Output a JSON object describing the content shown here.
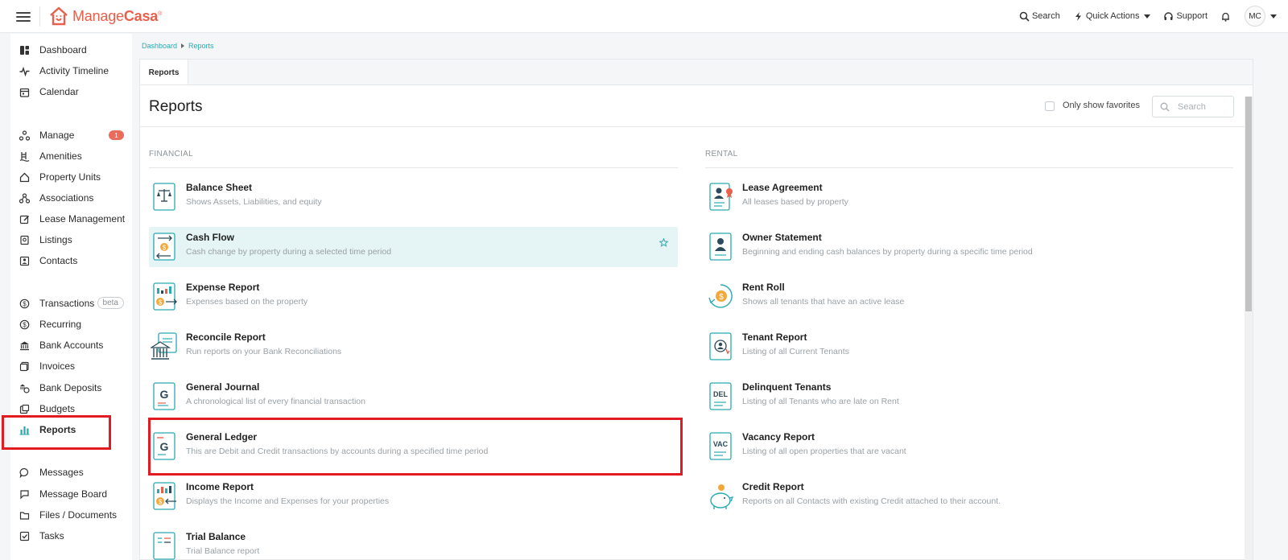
{
  "app": {
    "logo_text_light": "Manage",
    "logo_text_bold": "Casa"
  },
  "topbar": {
    "search_label": "Search",
    "quick_actions_label": "Quick Actions",
    "support_label": "Support",
    "avatar_initials": "MC"
  },
  "sidebar": {
    "items": [
      {
        "label": "Dashboard",
        "icon": "dashboard-icon"
      },
      {
        "label": "Activity Timeline",
        "icon": "pulse-icon"
      },
      {
        "label": "Calendar",
        "icon": "calendar-icon"
      },
      {
        "label": "Manage",
        "icon": "manage-icon",
        "badge": "1"
      },
      {
        "label": "Amenities",
        "icon": "amenities-icon"
      },
      {
        "label": "Property Units",
        "icon": "home-icon"
      },
      {
        "label": "Associations",
        "icon": "associations-icon"
      },
      {
        "label": "Lease Management",
        "icon": "edit-icon"
      },
      {
        "label": "Listings",
        "icon": "listings-icon"
      },
      {
        "label": "Contacts",
        "icon": "contacts-icon"
      },
      {
        "label": "Transactions",
        "icon": "dollar-icon",
        "tag": "beta"
      },
      {
        "label": "Recurring",
        "icon": "recurring-icon"
      },
      {
        "label": "Bank Accounts",
        "icon": "bank-icon"
      },
      {
        "label": "Invoices",
        "icon": "invoice-icon"
      },
      {
        "label": "Bank Deposits",
        "icon": "deposit-icon"
      },
      {
        "label": "Budgets",
        "icon": "budget-icon"
      },
      {
        "label": "Reports",
        "icon": "bar-chart-icon"
      },
      {
        "label": "Messages",
        "icon": "chat-icon"
      },
      {
        "label": "Message Board",
        "icon": "board-icon"
      },
      {
        "label": "Files / Documents",
        "icon": "folder-icon"
      },
      {
        "label": "Tasks",
        "icon": "tasks-icon"
      }
    ]
  },
  "breadcrumb": {
    "root": "Dashboard",
    "current": "Reports"
  },
  "tabs": {
    "active": "Reports"
  },
  "main": {
    "title": "Reports",
    "favorites_label": "Only show favorites",
    "search_placeholder": "Search",
    "financial_header": "FINANCIAL",
    "rental_header": "RENTAL",
    "financial_reports": [
      {
        "name": "Balance Sheet",
        "desc": "Shows Assets, Liabilities, and equity"
      },
      {
        "name": "Cash Flow",
        "desc": "Cash change by property during a selected time period"
      },
      {
        "name": "Expense Report",
        "desc": "Expenses based on the property"
      },
      {
        "name": "Reconcile Report",
        "desc": "Run reports on your Bank Reconciliations"
      },
      {
        "name": "General Journal",
        "desc": "A chronological list of every financial transaction"
      },
      {
        "name": "General Ledger",
        "desc": "This are Debit and Credit transactions by accounts during a specified time period"
      },
      {
        "name": "Income Report",
        "desc": "Displays the Income and Expenses for your properties"
      },
      {
        "name": "Trial Balance",
        "desc": "Trial Balance report"
      }
    ],
    "rental_reports": [
      {
        "name": "Lease Agreement",
        "desc": "All leases based by property"
      },
      {
        "name": "Owner Statement",
        "desc": "Beginning and ending cash balances by property during a specific time period"
      },
      {
        "name": "Rent Roll",
        "desc": "Shows all tenants that have an active lease"
      },
      {
        "name": "Tenant Report",
        "desc": "Listing of all Current Tenants"
      },
      {
        "name": "Delinquent Tenants",
        "desc": "Listing of all Tenants who are late on Rent"
      },
      {
        "name": "Vacancy Report",
        "desc": "Listing of all open properties that are vacant"
      },
      {
        "name": "Credit Report",
        "desc": "Reports on all Contacts with existing Credit attached to their account."
      }
    ],
    "icon_text": {
      "general": "G",
      "delinquent": "DEL",
      "vacancy": "VAC",
      "dollar": "$"
    }
  },
  "colors": {
    "accent": "#2aa9b1",
    "brand": "#e8604c",
    "highlight": "#e21b23",
    "hover_row": "#e5f4f5"
  }
}
